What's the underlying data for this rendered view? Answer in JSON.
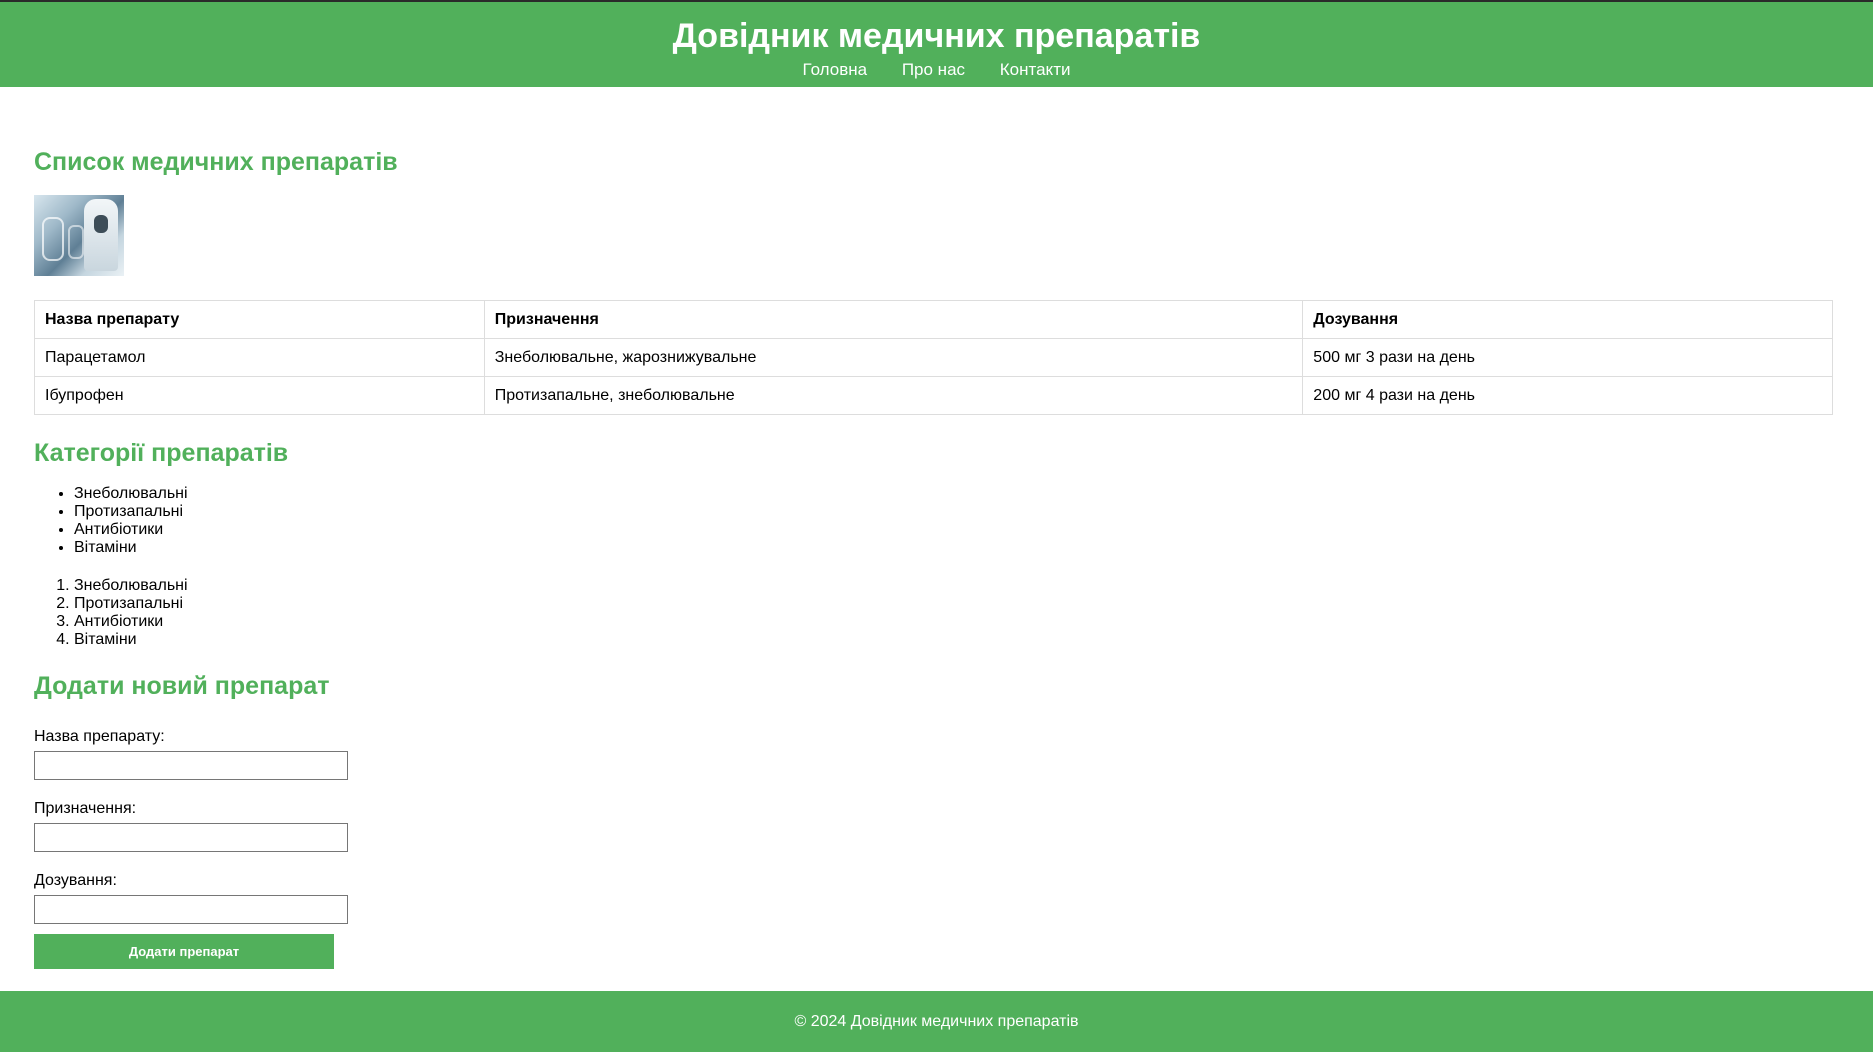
{
  "header": {
    "title": "Довідник медичних препаратів",
    "nav": [
      "Головна",
      "Про нас",
      "Контакти"
    ]
  },
  "list_section": {
    "heading": "Список медичних препаратів",
    "image_alt": "medical-image",
    "table": {
      "headers": [
        "Назва препарату",
        "Призначення",
        "Дозування"
      ],
      "rows": [
        [
          "Парацетамол",
          "Знеболювальне, жарознижувальне",
          "500 мг 3 рази на день"
        ],
        [
          "Ібупрофен",
          "Протизапальне, знеболювальне",
          "200 мг 4 рази на день"
        ]
      ]
    }
  },
  "categories": {
    "heading": "Категорії препаратів",
    "unordered": [
      "Знеболювальні",
      "Протизапальні",
      "Антибіотики",
      "Вітаміни"
    ],
    "ordered": [
      "Знеболювальні",
      "Протизапальні",
      "Антибіотики",
      "Вітаміни"
    ]
  },
  "form": {
    "heading": "Додати новий препарат",
    "fields": [
      {
        "label": "Назва препарату:",
        "value": ""
      },
      {
        "label": "Призначення:",
        "value": ""
      },
      {
        "label": "Дозування:",
        "value": ""
      }
    ],
    "submit_label": "Додати препарат"
  },
  "footer": {
    "text": "© 2024 Довідник медичних препаратів"
  },
  "colors": {
    "accent": "#51b05b",
    "header_text": "#ffffff"
  }
}
